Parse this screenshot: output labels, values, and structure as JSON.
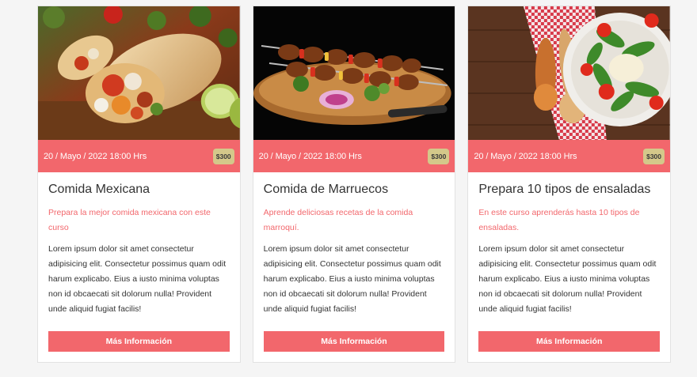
{
  "cards": [
    {
      "image": "burrito-photo",
      "date": "20 / Mayo / 2022 18:00 Hrs",
      "price": "$300",
      "title": "Comida Mexicana",
      "subtitle": "Prepara la mejor comida mexicana con este curso",
      "description": "Lorem ipsum dolor sit amet consectetur adipisicing elit. Consectetur possimus quam odit harum explicabo. Eius a iusto minima voluptas non id obcaecati sit dolorum nulla! Provident unde aliquid fugiat facilis!",
      "button": "Más Información"
    },
    {
      "image": "kebab-photo",
      "date": "20 / Mayo / 2022 18:00 Hrs",
      "price": "$300",
      "title": "Comida de Marruecos",
      "subtitle": "Aprende deliciosas recetas de la comida marroquí.",
      "description": "Lorem ipsum dolor sit amet consectetur adipisicing elit. Consectetur possimus quam odit harum explicabo. Eius a iusto minima voluptas non id obcaecati sit dolorum nulla! Provident unde aliquid fugiat facilis!",
      "button": "Más Información"
    },
    {
      "image": "salad-photo",
      "date": "20 / Mayo / 2022 18:00 Hrs",
      "price": "$300",
      "title": "Prepara 10 tipos de ensaladas",
      "subtitle": "En este curso aprenderás hasta 10 tipos de ensaladas.",
      "description": "Lorem ipsum dolor sit amet consectetur adipisicing elit. Consectetur possimus quam odit harum explicabo. Eius a iusto minima voluptas non id obcaecati sit dolorum nulla! Provident unde aliquid fugiat facilis!",
      "button": "Más Información"
    }
  ],
  "colors": {
    "accent": "#f2676c",
    "price_badge": "#d4c88a",
    "page_background": "#f5f5f5"
  }
}
